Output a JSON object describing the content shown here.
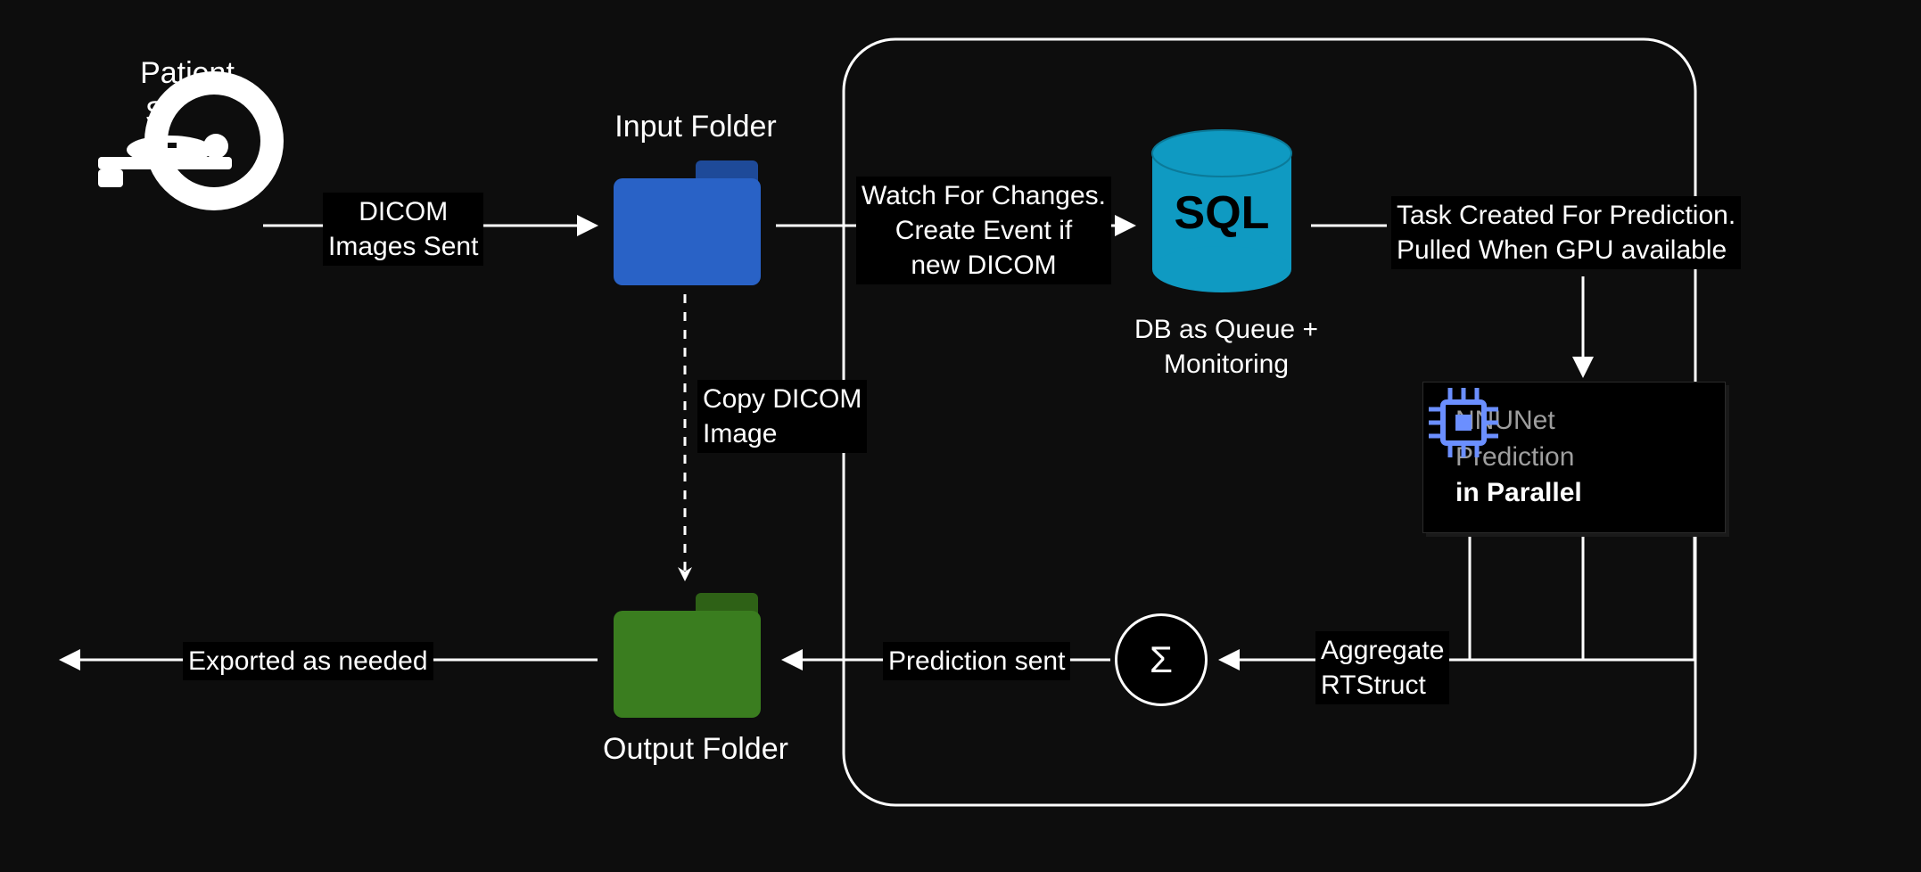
{
  "nodes": {
    "patient_scans": {
      "title_line1": "Patient",
      "title_line2": "Scans"
    },
    "input_folder": {
      "label": "Input Folder"
    },
    "db": {
      "label_line1": "DB as Queue +",
      "label_line2": "Monitoring",
      "icon_text": "SQL"
    },
    "nnunet": {
      "line1": "NNUNet",
      "line2": "Prediction",
      "line3": "in Parallel"
    },
    "sigma": {
      "symbol": "Σ"
    },
    "output_folder": {
      "label": "Output Folder"
    }
  },
  "edges": {
    "dicom_sent": {
      "line1": "DICOM",
      "line2": "Images Sent"
    },
    "watch_changes": {
      "line1": "Watch For Changes.",
      "line2": "Create Event if",
      "line3": "new DICOM"
    },
    "task_created": {
      "line1": "Task Created For Prediction.",
      "line2": "Pulled When GPU available"
    },
    "aggregate": {
      "line1": "Aggregate",
      "line2": "RTStruct"
    },
    "prediction_sent": "Prediction sent",
    "copy_dicom": {
      "line1": "Copy DICOM",
      "line2": "Image"
    },
    "exported": "Exported as needed"
  },
  "colors": {
    "folder_blue": "#2962c6",
    "folder_blue_tab": "#1e4a99",
    "folder_green": "#3a7d1f",
    "folder_green_tab": "#2e6116",
    "sql_cyan": "#0f9ac2",
    "chip_blue": "#6b8fff",
    "white": "#ffffff",
    "gray_text": "#9e9e9e"
  }
}
